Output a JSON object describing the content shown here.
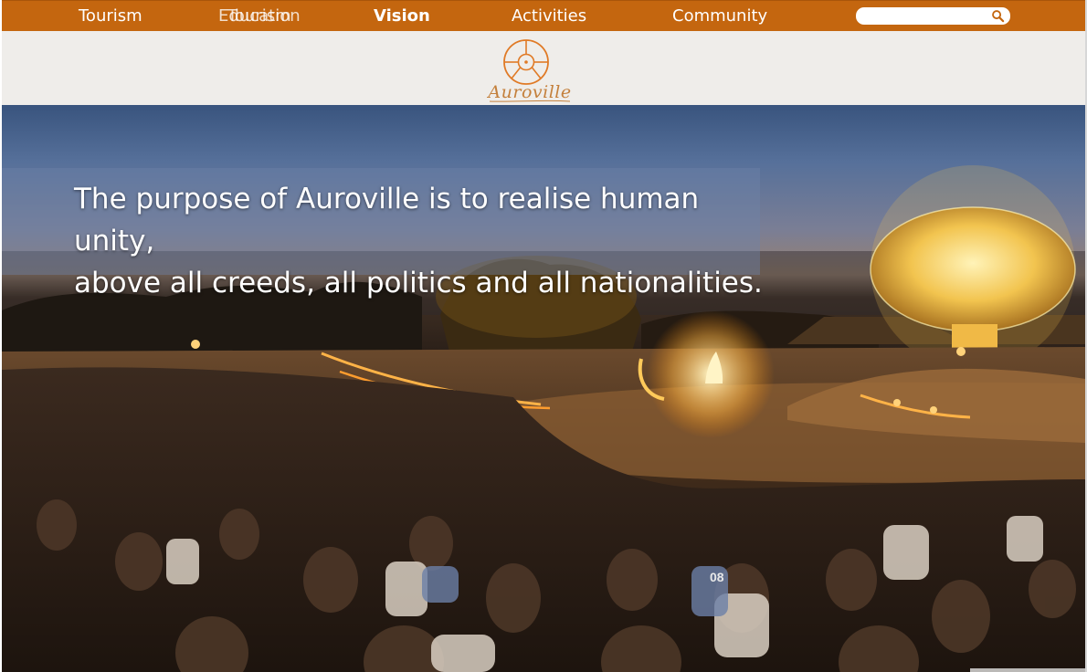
{
  "nav": {
    "items": [
      {
        "label": "Tourism"
      },
      {
        "label": "Education"
      },
      {
        "label": "Tourism"
      },
      {
        "label": "Vision"
      },
      {
        "label": "Activities"
      },
      {
        "label": "Community"
      }
    ],
    "active": "Vision",
    "search": {
      "placeholder": "",
      "value": ""
    }
  },
  "logo": {
    "script_text": "Auroville"
  },
  "hero": {
    "quote_line1": "The purpose of Auroville is to realise human unity,",
    "quote_line2": "above all creeds, all politics and all nationalities.",
    "photo_number": "08"
  },
  "colors": {
    "nav_bg": "#c4660f",
    "logo_band_bg": "#efedea",
    "logo_orange": "#e07a26",
    "quote_text": "#ffffff"
  }
}
